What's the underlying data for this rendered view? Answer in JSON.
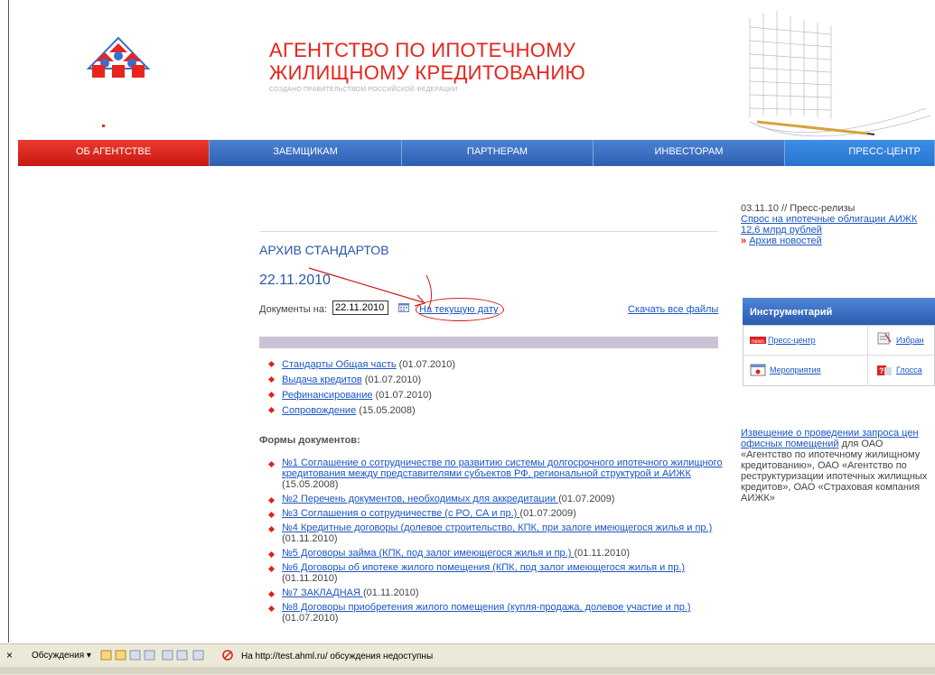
{
  "header": {
    "title_line1": "АГЕНТСТВО ПО ИПОТЕЧНОМУ",
    "title_line2": "ЖИЛИЩНОМУ КРЕДИТОВАНИЮ",
    "subtitle": "СОЗДАНО ПРАВИТЕЛЬСТВОМ РОССИЙСКОЙ ФЕДЕРАЦИИ",
    "logo_icon": "houses-logo-icon",
    "image_icon": "building-pencil-illustration"
  },
  "nav": {
    "items": [
      {
        "label": "ОБ АГЕНТСТВЕ"
      },
      {
        "label": "ЗАЕМЩИКАМ"
      },
      {
        "label": "ПАРТНЕРАМ"
      },
      {
        "label": "ИНВЕСТОРАМ"
      },
      {
        "label": "ПРЕСС-ЦЕНТР"
      }
    ]
  },
  "main": {
    "heading": "АРХИВ СТАНДАРТОВ",
    "date": "22.11.2010",
    "docs_label": "Документы на:",
    "date_value": "22.11.2010",
    "current_date_link": "На текущую дату",
    "download_all": "Скачать все файлы",
    "standards": [
      {
        "link": "Стандарты Общая часть",
        "date": " (01.07.2010)"
      },
      {
        "link": "Выдача кредитов",
        "date": " (01.07.2010)"
      },
      {
        "link": "Рефинансирование",
        "date": " (01.07.2010)"
      },
      {
        "link": "Сопровождение",
        "date": " (15.05.2008)"
      }
    ],
    "forms_title": "Формы документов:",
    "forms": [
      {
        "link": "№1 Соглашение о сотрудничестве по развитию системы долгосрочного ипотечного жилищного кредитования между представителями субъектов РФ, региональной структурой и АИЖК ",
        "date": "(15.05.2008)"
      },
      {
        "link": "№2 Перечень документов, необходимых для аккредитации ",
        "date": "(01.07.2009)"
      },
      {
        "link": "№3 Соглашения о сотрудничестве (с РО, СА и пр.) ",
        "date": "(01.07.2009)"
      },
      {
        "link": "№4 Кредитные договоры (долевое строительство, КПК, при залоге имеющегося жилья и пр.)",
        "date": "(01.11.2010)"
      },
      {
        "link": "№5 Договоры займа (КПК, под залог имеющегося жилья и пр.) ",
        "date": "(01.11.2010)"
      },
      {
        "link": "№6 Договоры об ипотеке жилого помещения (КПК, под залог имеющегося жилья и пр.)",
        "date": "(01.11.2010)"
      },
      {
        "link": "№7 ЗАКЛАДНАЯ ",
        "date": "(01.11.2010)"
      },
      {
        "link": "№8 Договоры приобретения жилого помещения (купля-продажа, долевое участие и пр.)",
        "date": "(01.07.2010)"
      }
    ]
  },
  "right": {
    "news_meta": "03.11.10 // Пресс-релизы",
    "news_link": "Спрос на ипотечные облигации АИЖК 12,6 млрд рублей",
    "archive_news": "Архив новостей",
    "tools_title": "Инструментарий",
    "tools": [
      {
        "label": "Пресс-центр",
        "icon": "news-icon"
      },
      {
        "label": "Избран",
        "icon": "notepad-icon"
      },
      {
        "label": "Мероприятия",
        "icon": "calendar-icon"
      },
      {
        "label": "Глосса",
        "icon": "question-icon"
      }
    ],
    "notice_link": "Извещение о проведении запроса цен офисных помещений",
    "notice_text": " для ОАО «Агентство по ипотечному жилищному кредитованию», ОАО «Агентство по реструктуризации ипотечных жилищных кредитов», ОАО «Страховая компания АИЖК»"
  },
  "toolbar": {
    "close": "×",
    "discussions": "Обсуждения ▾",
    "status": "На http://test.ahml.ru/ обсуждения недоступны"
  },
  "colors": {
    "accent_red": "#e8241c",
    "nav_blue": "#2f5fb2",
    "link": "#1a55c4"
  }
}
